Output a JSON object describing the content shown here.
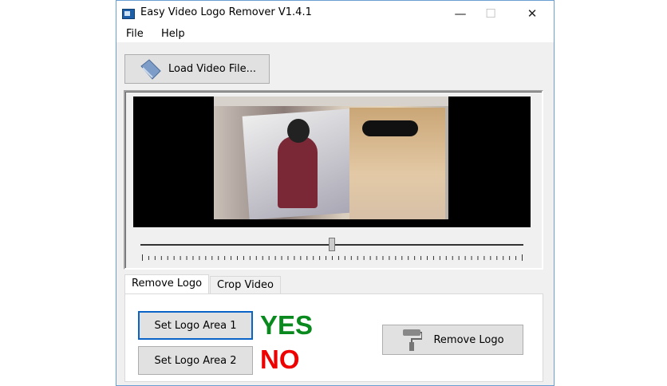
{
  "window": {
    "title": "Easy Video Logo Remover V1.4.1",
    "minimize": "—",
    "maximize": "☐",
    "close": "✕"
  },
  "menu": [
    "File",
    "Help"
  ],
  "toolbar": {
    "load_label": "Load Video File..."
  },
  "slider": {
    "position": 0.5
  },
  "tabs": [
    "Remove Logo",
    "Crop Video"
  ],
  "remove_logo_tab": {
    "set_area_1": "Set Logo Area 1",
    "set_area_2": "Set Logo Area 2",
    "status_1": "YES",
    "status_2": "NO",
    "remove_label": "Remove Logo"
  },
  "colors": {
    "yes": "#0a8a1e",
    "no": "#ee0000",
    "focus": "#0a64c8"
  }
}
